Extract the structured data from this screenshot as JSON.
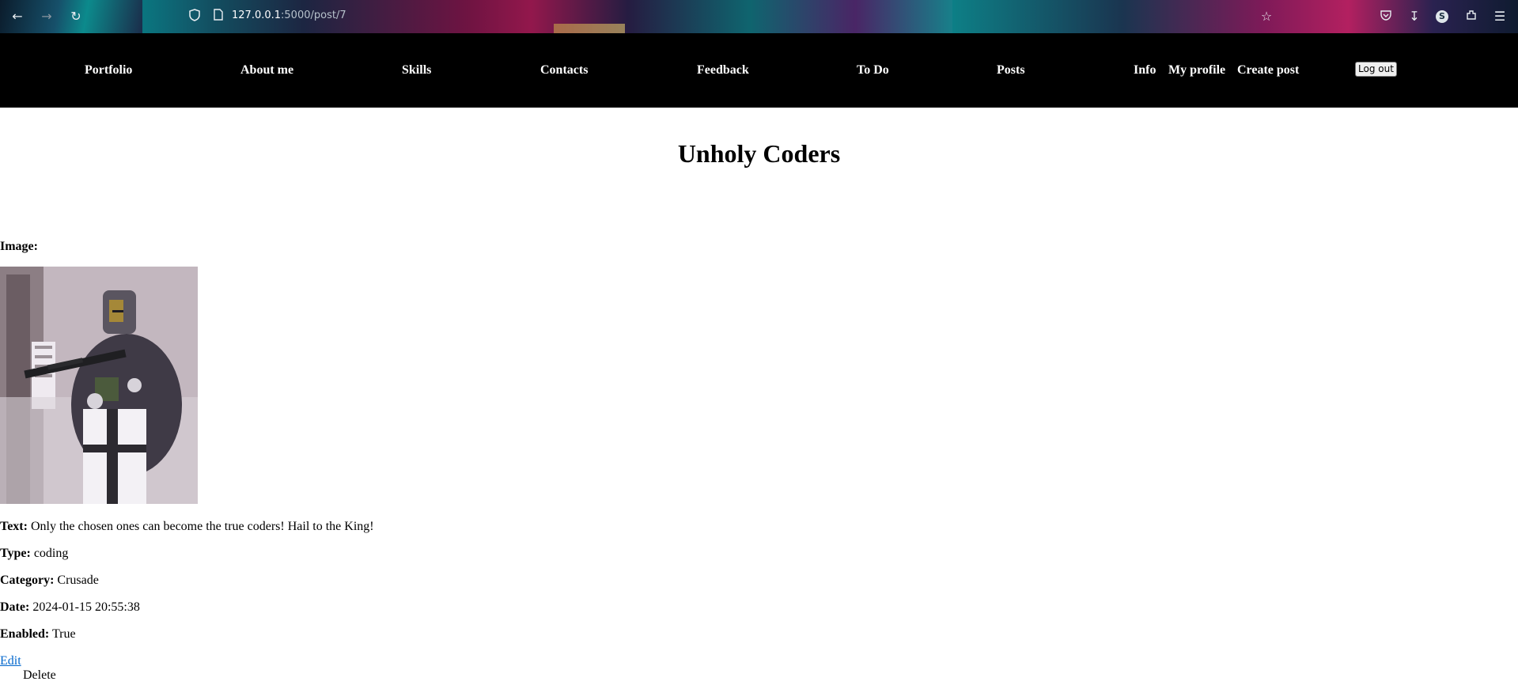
{
  "browser": {
    "url_host": "127.0.0.1",
    "url_rest": ":5000/post/7",
    "profile_initial": "S"
  },
  "nav": {
    "items": [
      "Portfolio",
      "About me",
      "Skills",
      "Contacts",
      "Feedback",
      "To Do",
      "Posts",
      "Info",
      "My profile",
      "Create post"
    ],
    "logout_label": "Log out"
  },
  "post": {
    "title": "Unholy Coders",
    "image_label": "Image:",
    "text_label": "Text:",
    "text_value": "Only the chosen ones can become the true coders! Hail to the King!",
    "type_label": "Type:",
    "type_value": "coding",
    "category_label": "Category:",
    "category_value": "Crusade",
    "date_label": "Date:",
    "date_value": "2024-01-15 20:55:38",
    "enabled_label": "Enabled:",
    "enabled_value": "True",
    "edit_label": "Edit",
    "delete_label": "Delete"
  }
}
